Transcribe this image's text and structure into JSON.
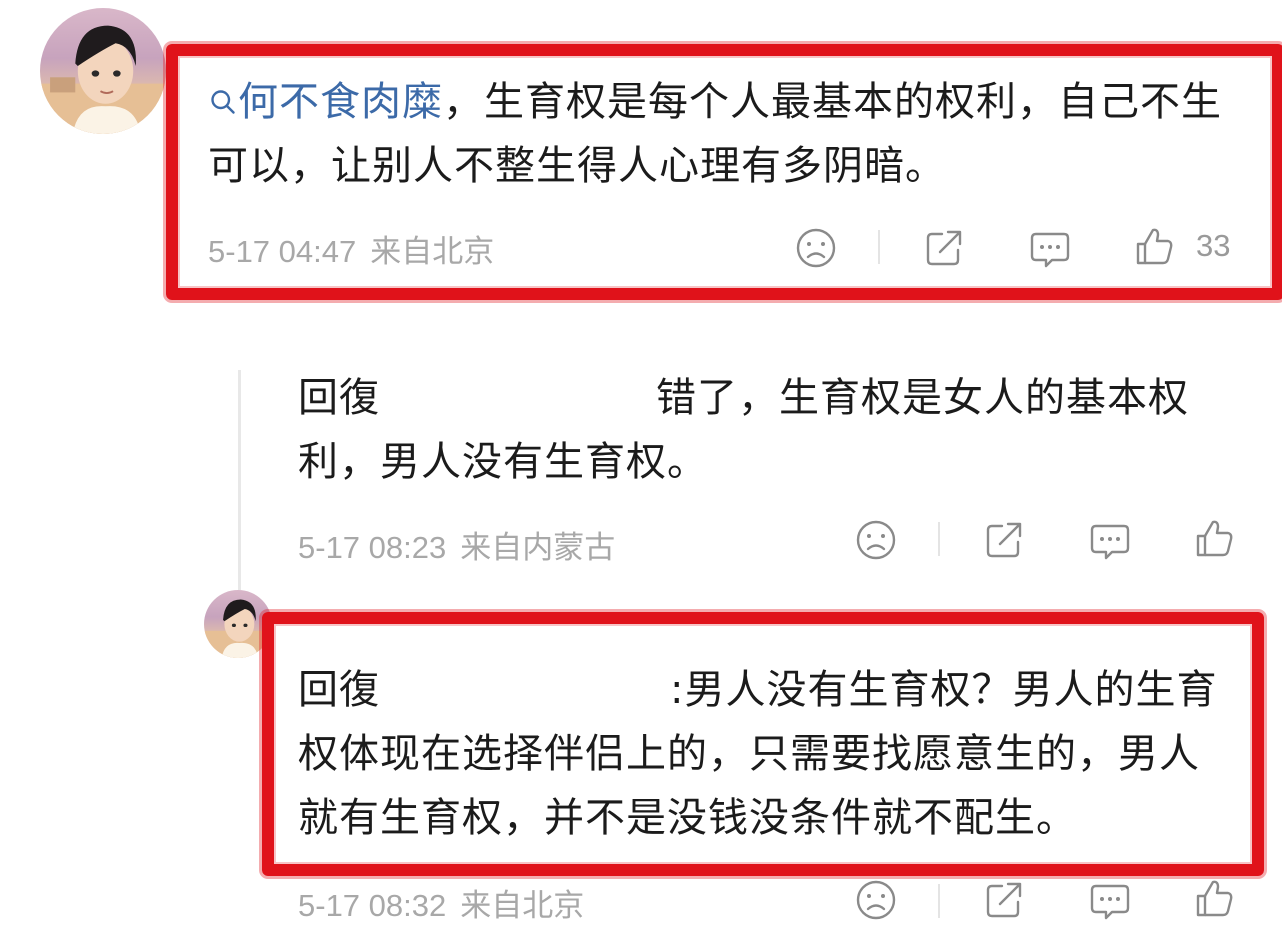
{
  "main_comment": {
    "mention": "何不食肉糜",
    "body_rest": "，生育权是每个人最基本的权利，自己不生可以，让别人不整生得人心理有多阴暗。",
    "time": "5-17 04:47",
    "location": "来自北京",
    "likes": "33"
  },
  "reply_1": {
    "prefix": "回復",
    "body": "错了，生育权是女人的基本权利，男人没有生育权。",
    "time": "5-17 08:23",
    "location": "来自内蒙古"
  },
  "reply_2": {
    "prefix": "回復",
    "body": ":男人没有生育权？男人的生育权体现在选择伴侣上的，只需要找愿意生的，男人就有生育权，并不是没钱没条件就不配生。",
    "time": "5-17 08:32",
    "location": "来自北京"
  },
  "colors": {
    "mention": "#3c6aa8",
    "highlight_box": "#e0121a",
    "meta_text": "#a8a8a8"
  },
  "icons": [
    "sad-face-icon",
    "share-icon",
    "comment-icon",
    "thumbs-up-icon"
  ]
}
